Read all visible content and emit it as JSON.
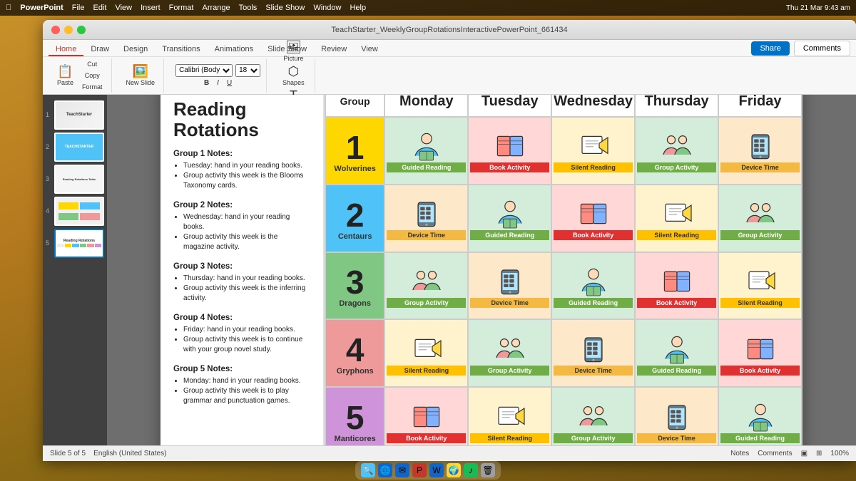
{
  "menubar": {
    "app": "PowerPoint",
    "menus": [
      "File",
      "Edit",
      "View",
      "Insert",
      "Format",
      "Arrange",
      "Tools",
      "Slide Show",
      "Window",
      "Help"
    ],
    "time": "Thu 21 Mar  9:43 am",
    "right_icons": [
      "wifi",
      "battery",
      "dial"
    ]
  },
  "window": {
    "title": "TeachStarter_WeeklyGroupRotationsInteractivePowerPoint_661434",
    "traffic_lights": [
      "close",
      "minimize",
      "maximize"
    ]
  },
  "ribbon": {
    "tabs": [
      "Home",
      "Draw",
      "Design",
      "Transitions",
      "Animations",
      "Slide Show",
      "Review",
      "View"
    ],
    "active_tab": "Home",
    "share_label": "Share",
    "comments_label": "Comments"
  },
  "slide": {
    "title": "Reading Rotations",
    "groups": [
      {
        "number": "1",
        "name": "Wolverines",
        "color": "g1",
        "notes_title": "Group 1 Notes:",
        "notes": [
          "Tuesday: hand in your reading books.",
          "Group activity this week is the Blooms Taxonomy cards."
        ],
        "activities": {
          "monday": "Guided Reading",
          "tuesday": "Book Activity",
          "wednesday": "Silent Reading",
          "thursday": "Group Activity",
          "friday": "Device Time"
        }
      },
      {
        "number": "2",
        "name": "Centaurs",
        "color": "g2",
        "notes_title": "Group 2 Notes:",
        "notes": [
          "Wednesday: hand in your reading books.",
          "Group activity this week is the magazine activity."
        ],
        "activities": {
          "monday": "Device Time",
          "tuesday": "Guided Reading",
          "wednesday": "Book Activity",
          "thursday": "Silent Reading",
          "friday": "Group Activity"
        }
      },
      {
        "number": "3",
        "name": "Dragons",
        "color": "g3",
        "notes_title": "Group 3 Notes:",
        "notes": [
          "Thursday: hand in your reading books.",
          "Group activity this week is the inferring activity."
        ],
        "activities": {
          "monday": "Group Activity",
          "tuesday": "Device Time",
          "wednesday": "Guided Reading",
          "thursday": "Book Activity",
          "friday": "Silent Reading"
        }
      },
      {
        "number": "4",
        "name": "Gryphons",
        "color": "g4",
        "notes_title": "Group 4 Notes:",
        "notes": [
          "Friday: hand in your reading books.",
          "Group activity this week is to continue with your group novel study."
        ],
        "activities": {
          "monday": "Silent Reading",
          "tuesday": "Group Activity",
          "wednesday": "Device Time",
          "thursday": "Guided Reading",
          "friday": "Book Activity"
        }
      },
      {
        "number": "5",
        "name": "Manticores",
        "color": "g5",
        "notes_title": "Group 5 Notes:",
        "notes": [
          "Monday: hand in your reading books.",
          "Group activity this week is to play grammar and punctuation games."
        ],
        "activities": {
          "monday": "Book Activity",
          "tuesday": "Silent Reading",
          "wednesday": "Group Activity",
          "thursday": "Device Time",
          "friday": "Guided Reading"
        }
      }
    ],
    "days": [
      "Group",
      "Monday",
      "Tuesday",
      "Wednesday",
      "Thursday",
      "Friday"
    ]
  },
  "statusbar": {
    "slide_info": "Slide 5 of 5",
    "language": "English (United States)",
    "notes": "Notes",
    "comments": "Comments",
    "zoom": "100%"
  },
  "activity_icons": {
    "Guided Reading": "👨‍👩‍👧",
    "Book Activity": "📖",
    "Silent Reading": "✏️",
    "Group Activity": "👥",
    "Device Time": "📱"
  },
  "activity_colors": {
    "Guided Reading": {
      "bg": "#d4edda",
      "label_bg": "#70ad47",
      "label_color": "white"
    },
    "Book Activity": {
      "bg": "#ffd7d7",
      "label_bg": "#e03030",
      "label_color": "white"
    },
    "Silent Reading": {
      "bg": "#fff3cd",
      "label_bg": "#ffc000",
      "label_color": "#333"
    },
    "Group Activity": {
      "bg": "#d4edda",
      "label_bg": "#70ad47",
      "label_color": "white"
    },
    "Device Time": {
      "bg": "#fde9c9",
      "label_bg": "#f4b942",
      "label_color": "#333"
    }
  }
}
